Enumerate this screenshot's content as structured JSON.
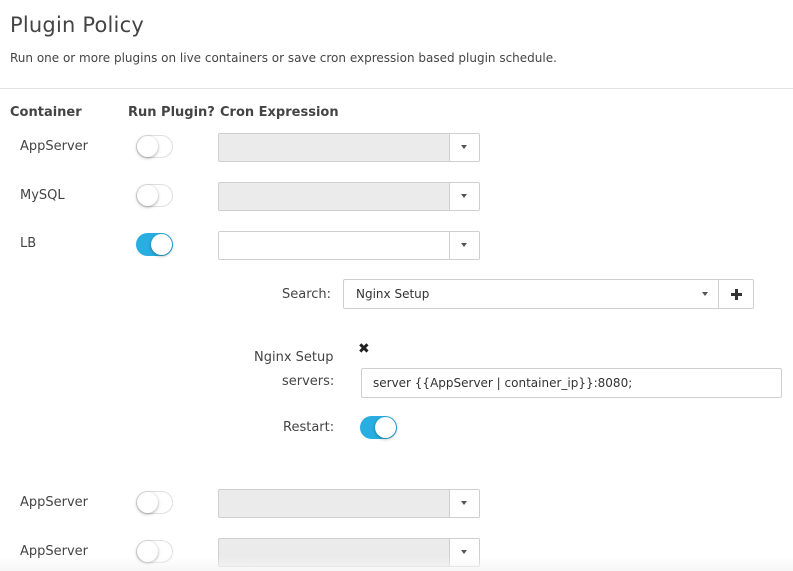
{
  "header": {
    "title": "Plugin Policy",
    "subtitle": "Run one or more plugins on live containers or save cron expression based plugin schedule."
  },
  "columns": {
    "container": "Container",
    "run_plugin": "Run Plugin?",
    "cron_expression": "Cron Expression"
  },
  "rows": [
    {
      "container": "AppServer",
      "run_plugin": false,
      "cron_value": ""
    },
    {
      "container": "MySQL",
      "run_plugin": false,
      "cron_value": ""
    },
    {
      "container": "LB",
      "run_plugin": true,
      "cron_value": ""
    },
    {
      "container": "AppServer",
      "run_plugin": false,
      "cron_value": ""
    },
    {
      "container": "AppServer",
      "run_plugin": false,
      "cron_value": ""
    }
  ],
  "plugin_panel": {
    "search_label": "Search:",
    "search_value": "Nginx Setup",
    "plugin_name": "Nginx Setup",
    "remove_glyph": "✖",
    "servers_label": "servers:",
    "servers_value": "server {{AppServer | container_ip}}:8080;",
    "restart_label": "Restart:",
    "restart_on": true
  },
  "colors": {
    "accent": "#29aee1",
    "disabled_field": "#ebebeb",
    "border": "#cfcfcf"
  },
  "icons": {
    "dropdown": "chevron-down-icon",
    "add": "plus-icon",
    "remove": "close-icon"
  }
}
